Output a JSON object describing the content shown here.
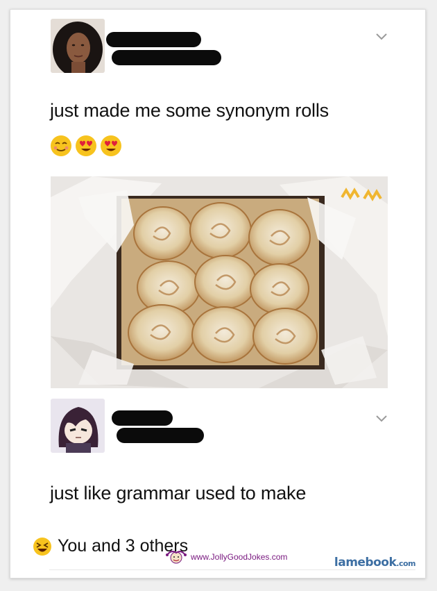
{
  "post": {
    "text": "just made me some synonym rolls",
    "emojis": [
      "relieved-face",
      "heart-eyes-face",
      "heart-eyes-face"
    ]
  },
  "reply": {
    "text": "just like grammar used to make"
  },
  "reactions": {
    "text": "You and 3 others",
    "emoji": "laughing-face"
  },
  "watermarks": {
    "jollygood": "www.JollyGoodJokes.com",
    "lamebook_main": "lamebook",
    "lamebook_tld": ".com"
  },
  "colors": {
    "watermark_purple": "#7a1a80",
    "lamebook_blue": "#3d6fa3",
    "emoji_yellow": "#f7c31e"
  }
}
